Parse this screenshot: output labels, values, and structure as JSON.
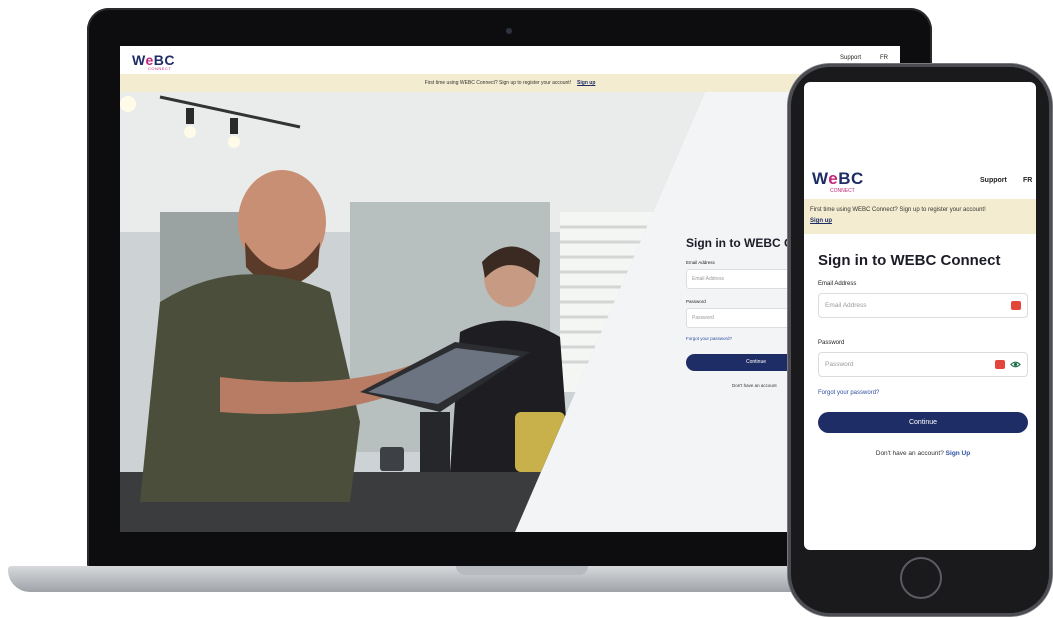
{
  "brand": {
    "logo_w": "W",
    "logo_e": "e",
    "logo_bc": "BC",
    "logo_sub": "CONNECT"
  },
  "nav": {
    "support": "Support",
    "lang": "FR"
  },
  "banner": {
    "text": "First time using WEBC Connect? Sign up to register your account!",
    "link": "Sign up"
  },
  "form": {
    "title": "Sign in to WEBC Connect",
    "email_label": "Email Address",
    "email_placeholder": "Email Address",
    "password_label": "Password",
    "password_placeholder": "Password",
    "forgot": "Forgot your password?",
    "continue": "Continue",
    "no_account": "Don't have an account?",
    "signup": "Sign Up"
  },
  "laptop_form": {
    "title_visible": "Sign in to WEBC Co",
    "no_account_visible": "Don't have an account"
  },
  "colors": {
    "primary": "#1f2d66",
    "accent": "#c0267a",
    "banner_bg": "#f4ecd0",
    "link": "#2f4fa0",
    "badge": "#e4453b"
  }
}
